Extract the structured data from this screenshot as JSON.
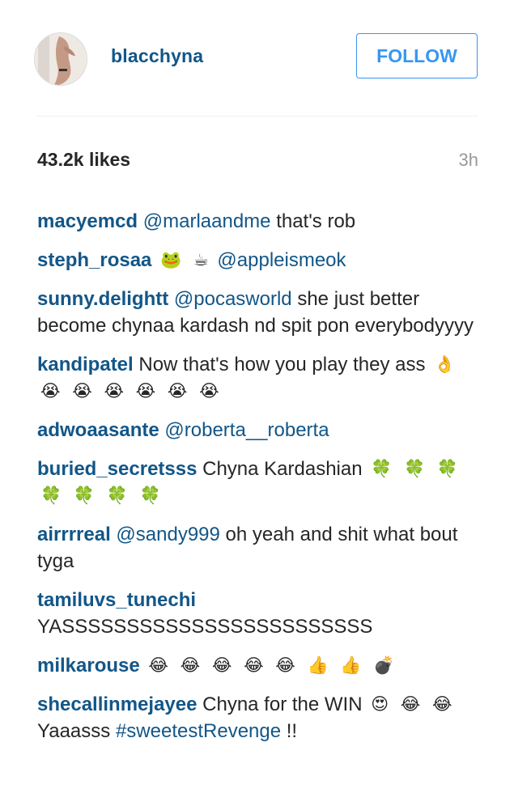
{
  "post_header": {
    "username": "blacchyna",
    "follow_label": "FOLLOW"
  },
  "stats": {
    "likes": "43.2k likes",
    "time": "3h"
  },
  "comments": [
    {
      "author": "macyemcd",
      "parts": [
        {
          "type": "mention",
          "text": "@marlaandme"
        },
        {
          "type": "text",
          "text": "that's rob"
        }
      ]
    },
    {
      "author": "steph_rosaa",
      "parts": [
        {
          "type": "emoji",
          "text": "🐸",
          "icon": "frog-emoji-icon"
        },
        {
          "type": "emoji",
          "text": "☕",
          "icon": "coffee-emoji-icon"
        },
        {
          "type": "mention",
          "text": "@appleismeok"
        }
      ]
    },
    {
      "author": "sunny.delightt",
      "parts": [
        {
          "type": "mention",
          "text": "@pocasworld"
        },
        {
          "type": "text",
          "text": "she just better become chynaa kardash nd spit pon everybodyyyy"
        }
      ]
    },
    {
      "author": "kandipatel",
      "parts": [
        {
          "type": "text",
          "text": "Now that's how you play they ass"
        },
        {
          "type": "emoji",
          "text": "👌",
          "icon": "ok-hand-emoji-icon"
        },
        {
          "type": "emoji",
          "text": "😭",
          "icon": "crying-face-emoji-icon"
        },
        {
          "type": "emoji",
          "text": "😭",
          "icon": "crying-face-emoji-icon"
        },
        {
          "type": "emoji",
          "text": "😭",
          "icon": "crying-face-emoji-icon"
        },
        {
          "type": "emoji",
          "text": "😭",
          "icon": "crying-face-emoji-icon"
        },
        {
          "type": "emoji",
          "text": "😭",
          "icon": "crying-face-emoji-icon"
        },
        {
          "type": "emoji",
          "text": "😭",
          "icon": "crying-face-emoji-icon"
        }
      ]
    },
    {
      "author": "adwoaasante",
      "parts": [
        {
          "type": "mention",
          "text": "@roberta__roberta"
        }
      ]
    },
    {
      "author": "buried_secretsss",
      "parts": [
        {
          "type": "text",
          "text": "Chyna Kardashian"
        },
        {
          "type": "emoji",
          "text": "🍀",
          "icon": "four-leaf-clover-emoji-icon"
        },
        {
          "type": "emoji",
          "text": "🍀",
          "icon": "four-leaf-clover-emoji-icon"
        },
        {
          "type": "emoji",
          "text": "🍀",
          "icon": "four-leaf-clover-emoji-icon"
        },
        {
          "type": "emoji",
          "text": "🍀",
          "icon": "four-leaf-clover-emoji-icon"
        },
        {
          "type": "emoji",
          "text": "🍀",
          "icon": "four-leaf-clover-emoji-icon"
        },
        {
          "type": "emoji",
          "text": "🍀",
          "icon": "four-leaf-clover-emoji-icon"
        },
        {
          "type": "emoji",
          "text": "🍀",
          "icon": "four-leaf-clover-emoji-icon"
        }
      ]
    },
    {
      "author": "airrrreal",
      "parts": [
        {
          "type": "mention",
          "text": "@sandy999"
        },
        {
          "type": "text",
          "text": "oh yeah and shit what bout tyga"
        }
      ]
    },
    {
      "author": "tamiluvs_tunechi",
      "parts": [
        {
          "type": "text",
          "text": "YASSSSSSSSSSSSSSSSSSSSSSSS"
        }
      ]
    },
    {
      "author": "milkarouse",
      "parts": [
        {
          "type": "emoji",
          "text": "😂",
          "icon": "tears-of-joy-emoji-icon"
        },
        {
          "type": "emoji",
          "text": "😂",
          "icon": "tears-of-joy-emoji-icon"
        },
        {
          "type": "emoji",
          "text": "😂",
          "icon": "tears-of-joy-emoji-icon"
        },
        {
          "type": "emoji",
          "text": "😂",
          "icon": "tears-of-joy-emoji-icon"
        },
        {
          "type": "emoji",
          "text": "😂",
          "icon": "tears-of-joy-emoji-icon"
        },
        {
          "type": "emoji",
          "text": "👍",
          "icon": "thumbs-up-emoji-icon"
        },
        {
          "type": "emoji",
          "text": "👍",
          "icon": "thumbs-up-emoji-icon"
        },
        {
          "type": "emoji",
          "text": "💣",
          "icon": "bomb-emoji-icon"
        }
      ]
    },
    {
      "author": "shecallinmejayee",
      "parts": [
        {
          "type": "text",
          "text": "Chyna for the WIN"
        },
        {
          "type": "emoji",
          "text": "😍",
          "icon": "heart-eyes-emoji-icon"
        },
        {
          "type": "emoji",
          "text": "😂",
          "icon": "tears-of-joy-emoji-icon"
        },
        {
          "type": "emoji",
          "text": "😂",
          "icon": "tears-of-joy-emoji-icon"
        },
        {
          "type": "text",
          "text": "Yaaasss"
        },
        {
          "type": "hashtag",
          "text": "#sweetestRevenge"
        },
        {
          "type": "text",
          "text": "!!"
        }
      ]
    }
  ]
}
